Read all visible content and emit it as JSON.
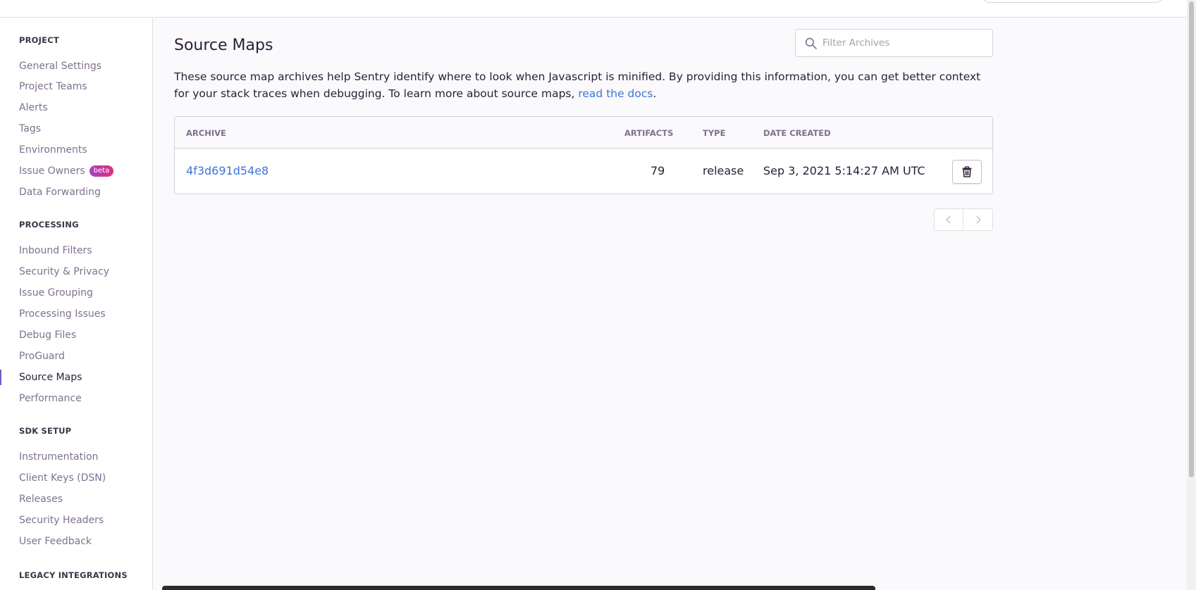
{
  "sidebar": {
    "sections": [
      {
        "title": "PROJECT",
        "items": [
          {
            "label": "General Settings"
          },
          {
            "label": "Project Teams"
          },
          {
            "label": "Alerts"
          },
          {
            "label": "Tags"
          },
          {
            "label": "Environments"
          },
          {
            "label": "Issue Owners",
            "badge": "beta"
          },
          {
            "label": "Data Forwarding"
          }
        ]
      },
      {
        "title": "PROCESSING",
        "items": [
          {
            "label": "Inbound Filters"
          },
          {
            "label": "Security & Privacy"
          },
          {
            "label": "Issue Grouping"
          },
          {
            "label": "Processing Issues"
          },
          {
            "label": "Debug Files"
          },
          {
            "label": "ProGuard"
          },
          {
            "label": "Source Maps",
            "active": true
          },
          {
            "label": "Performance"
          }
        ]
      },
      {
        "title": "SDK SETUP",
        "items": [
          {
            "label": "Instrumentation"
          },
          {
            "label": "Client Keys (DSN)"
          },
          {
            "label": "Releases"
          },
          {
            "label": "Security Headers"
          },
          {
            "label": "User Feedback"
          }
        ]
      },
      {
        "title": "LEGACY INTEGRATIONS",
        "items": []
      }
    ]
  },
  "main": {
    "title": "Source Maps",
    "filter": {
      "placeholder": "Filter Archives",
      "icon": "search-icon"
    },
    "description": {
      "text": "These source map archives help Sentry identify where to look when Javascript is minified. By providing this information, you can get better context for your stack traces when debugging. To learn more about source maps, ",
      "link_text": "read the docs",
      "suffix": "."
    },
    "table": {
      "columns": [
        "ARCHIVE",
        "ARTIFACTS",
        "TYPE",
        "DATE CREATED"
      ],
      "rows": [
        {
          "archive": "4f3d691d54e8",
          "artifacts": "79",
          "type": "release",
          "date_created": "Sep 3, 2021 5:14:27 AM UTC"
        }
      ],
      "row_action_icon": "trash-icon"
    },
    "pagination": {
      "prev_icon": "chevron-left-icon",
      "next_icon": "chevron-right-icon"
    }
  },
  "colors": {
    "accent": "#6c5fc7",
    "link": "#3d74db",
    "text": "#2b1d38",
    "muted": "#80708f",
    "border": "#d6d0dc"
  }
}
